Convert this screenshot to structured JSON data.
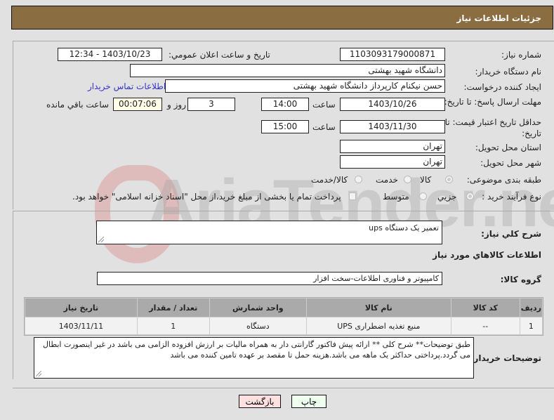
{
  "header": {
    "title": "جزئیات اطلاعات نیاز"
  },
  "form": {
    "need_number_label": "شماره نیاز:",
    "need_number": "1103093179000871",
    "announce_label": "تاريخ و ساعت اعلان عمومي:",
    "announce_value": "1403/10/23 - 12:34",
    "buyer_org_label": "نام دستگاه خريدار:",
    "buyer_org": "دانشگاه شهید بهشتی",
    "creator_label": "ايجاد کننده درخواست:",
    "creator": "حسن نیکنام کارپرداز دانشگاه شهید بهشتی",
    "contact_link": "اطلاعات تماس خريدار",
    "reply_deadline_label": "مهلت ارسال پاسخ: تا تاریخ:",
    "reply_date": "1403/10/26",
    "time_label": "ساعت",
    "reply_time": "14:00",
    "days_value": "3",
    "days_label": "روز و",
    "remaining_time": "00:07:06",
    "remaining_label": "ساعت باقي مانده",
    "price_validity_label": "حداقل تاريخ اعتبار قيمت: تا تاریخ:",
    "price_date": "1403/11/30",
    "price_time": "15:00",
    "province_label": "استان محل تحويل:",
    "province": "تهران",
    "city_label": "شهر محل تحويل:",
    "city": "تهران",
    "category_label": "طبقه بندی موضوعی:",
    "category_options": [
      "کالا",
      "خدمت",
      "کالا/خدمت"
    ],
    "category_selected": "کالا",
    "process_label": "نوع فرآيند خريد :",
    "process_options": [
      "جزيي",
      "متوسط"
    ],
    "process_selected": "جزيي",
    "treasury_text": "پرداخت تمام يا بخشی از مبلغ خريد،از محل \"اسناد خزانه اسلامی\" خواهد بود."
  },
  "details": {
    "summary_label": "شرح کلي نياز:",
    "summary": "تعمیر یک دستگاه ups",
    "goods_info_title": "اطلاعات کالاهاي مورد نياز",
    "goods_group_label": "گروه کالا:",
    "goods_group": "کامپیوتر و فناوری اطلاعات-سخت افزار",
    "table": {
      "headers": [
        "رديف",
        "کد کالا",
        "نام کالا",
        "واحد شمارش",
        "تعداد / مقدار",
        "تاريخ نياز"
      ],
      "rows": [
        [
          "1",
          "--",
          "منبع تغذیه اضطراری UPS",
          "دستگاه",
          "1",
          "1403/11/11"
        ]
      ]
    },
    "buyer_notes_label": "توضيحات خريدار:",
    "buyer_notes": "طبق توضیحات** شرح کلی  ** ارائه پیش فاکتور  گارانتی دار به همراه مالیات بر ارزش افزوده الزامی می باشد در غیر اینصورت ابطال می گردد.پرداختی حداکثر یک ماهه می باشد.هزینه حمل تا مقصد بر عهده تامین کننده می باشد"
  },
  "buttons": {
    "print": "چاپ",
    "back": "بازگشت"
  },
  "watermark": "AriaTender.net"
}
